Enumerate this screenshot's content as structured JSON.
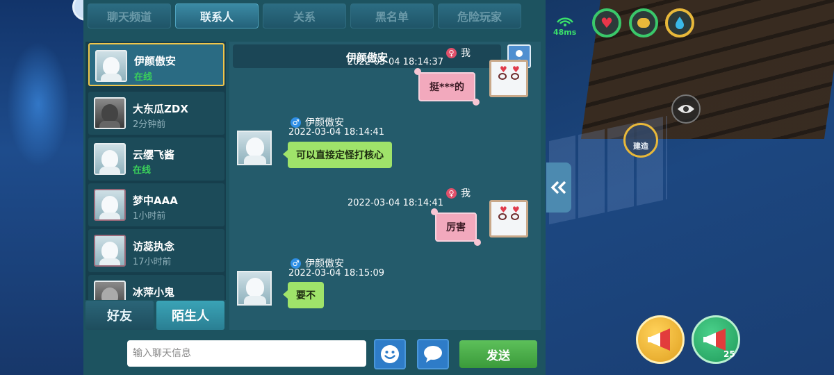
{
  "tabs": [
    {
      "label": "聊天频道",
      "active": false
    },
    {
      "label": "联系人",
      "active": true
    },
    {
      "label": "关系",
      "active": false
    },
    {
      "label": "黑名单",
      "active": false
    },
    {
      "label": "危险玩家",
      "active": false
    }
  ],
  "contacts": [
    {
      "name": "伊颜傲安",
      "status": "在线",
      "online": true,
      "selected": true
    },
    {
      "name": "大东瓜ZDX",
      "status": "2分钟前",
      "online": false,
      "selected": false
    },
    {
      "name": "云缨飞酱",
      "status": "在线",
      "online": true,
      "selected": false
    },
    {
      "name": "梦中AAA",
      "status": "1小时前",
      "online": false,
      "selected": false
    },
    {
      "name": "访蕊执念",
      "status": "17小时前",
      "online": false,
      "selected": false
    },
    {
      "name": "冰萍小鬼",
      "status": "",
      "online": false,
      "selected": false
    }
  ],
  "bottom_tabs": {
    "friends": "好友",
    "strangers": "陌生人",
    "active": "strangers"
  },
  "chat": {
    "title": "伊颜傲安",
    "messages": [
      {
        "from": "me",
        "sender": "我",
        "timestamp": "2022-03-04   18:14:37",
        "text": "挺***的"
      },
      {
        "from": "other",
        "sender": "伊颜傲安",
        "timestamp": "2022-03-04   18:14:41",
        "text": "可以直接定怪打核心"
      },
      {
        "from": "me",
        "sender": "我",
        "timestamp": "2022-03-04   18:14:41",
        "text": "厉害"
      },
      {
        "from": "other",
        "sender": "伊颜傲安",
        "timestamp": "2022-03-04   18:15:09",
        "text": "要不"
      }
    ]
  },
  "input": {
    "placeholder": "输入聊天信息",
    "value": ""
  },
  "send_label": "发送",
  "hud": {
    "signal": "48ms",
    "build_label": "建造",
    "megaphone_count": "25",
    "icons": [
      "heart-icon",
      "hunger-icon",
      "water-drop-icon"
    ]
  },
  "colors": {
    "panel": "#1d5360",
    "active_tab": "#3b8aa4",
    "online_green": "#3ad05a",
    "other_bubble": "#9fe36a",
    "my_bubble": "#f2a9bd",
    "send_button": "#4aae48",
    "selected_border": "#f0c64a"
  }
}
